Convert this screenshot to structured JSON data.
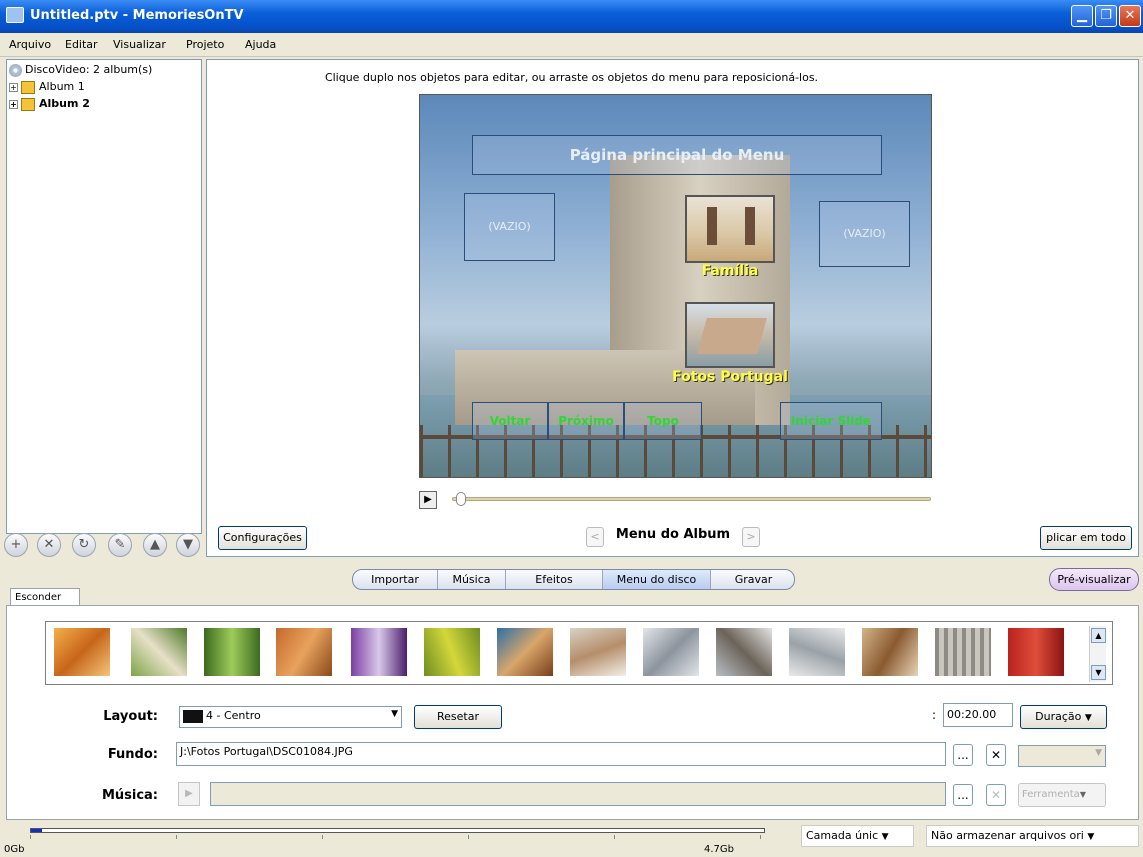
{
  "window": {
    "title": "Untitled.ptv - MemoriesOnTV",
    "controls": [
      "minimize",
      "restore",
      "close"
    ]
  },
  "menu": [
    "Arquivo",
    "Editar",
    "Visualizar",
    "Projeto",
    "Ajuda"
  ],
  "tree": {
    "root": "DiscoVideo: 2 album(s)",
    "albums": [
      "Album 1",
      "Album 2"
    ],
    "toolbar_icons": [
      "plus-icon",
      "x-icon",
      "refresh-icon",
      "pencil-icon",
      "up-icon",
      "down-icon"
    ]
  },
  "preview": {
    "hint": "Clique duplo nos objetos para editar, ou arraste os objetos do menu para reposicioná-los.",
    "menu_title": "Página principal do Menu",
    "empty_left": "(VAZIO)",
    "empty_right": "(VAZIO)",
    "item1_label": "Família",
    "item2_label": "Fotos Portugal",
    "nav_buttons": [
      "Voltar",
      "Próximo",
      "Topo",
      "Iniciar Slide"
    ],
    "config_button": "Configurações",
    "page_label": "Menu do Album",
    "apply_button": "plicar em todo"
  },
  "tabs": [
    "Importar",
    "Música",
    "Efeitos",
    "Menu do disco",
    "Gravar"
  ],
  "active_tab": "Menu do disco",
  "preview_button": "Pré-visualizar",
  "hide_tab": "Esconder",
  "controls": {
    "layout_label": "Layout:",
    "layout_value": "4 - Centro",
    "reset_button": "Resetar",
    "duration_prefix": ":",
    "duration_value": "00:20.00",
    "duration_button": "Duração",
    "background_label": "Fundo:",
    "background_value": "J:\\Fotos Portugal\\DSC01084.JPG",
    "music_label": "Música:",
    "music_value": "",
    "browse_button": "...",
    "tools_button": "Ferramenta"
  },
  "status": {
    "capacity_start": "0Gb",
    "capacity_end": "4.7Gb",
    "used_fraction": 0.015,
    "layer_select": "Camada únic",
    "storage_select": "Não armazenar arquivos ori"
  },
  "colors": {
    "title_bar": "#0a5fd8",
    "menu_label_yellow": "#ffff40",
    "nav_label_green": "#32d632",
    "preview_button": "#e6d3f5"
  }
}
